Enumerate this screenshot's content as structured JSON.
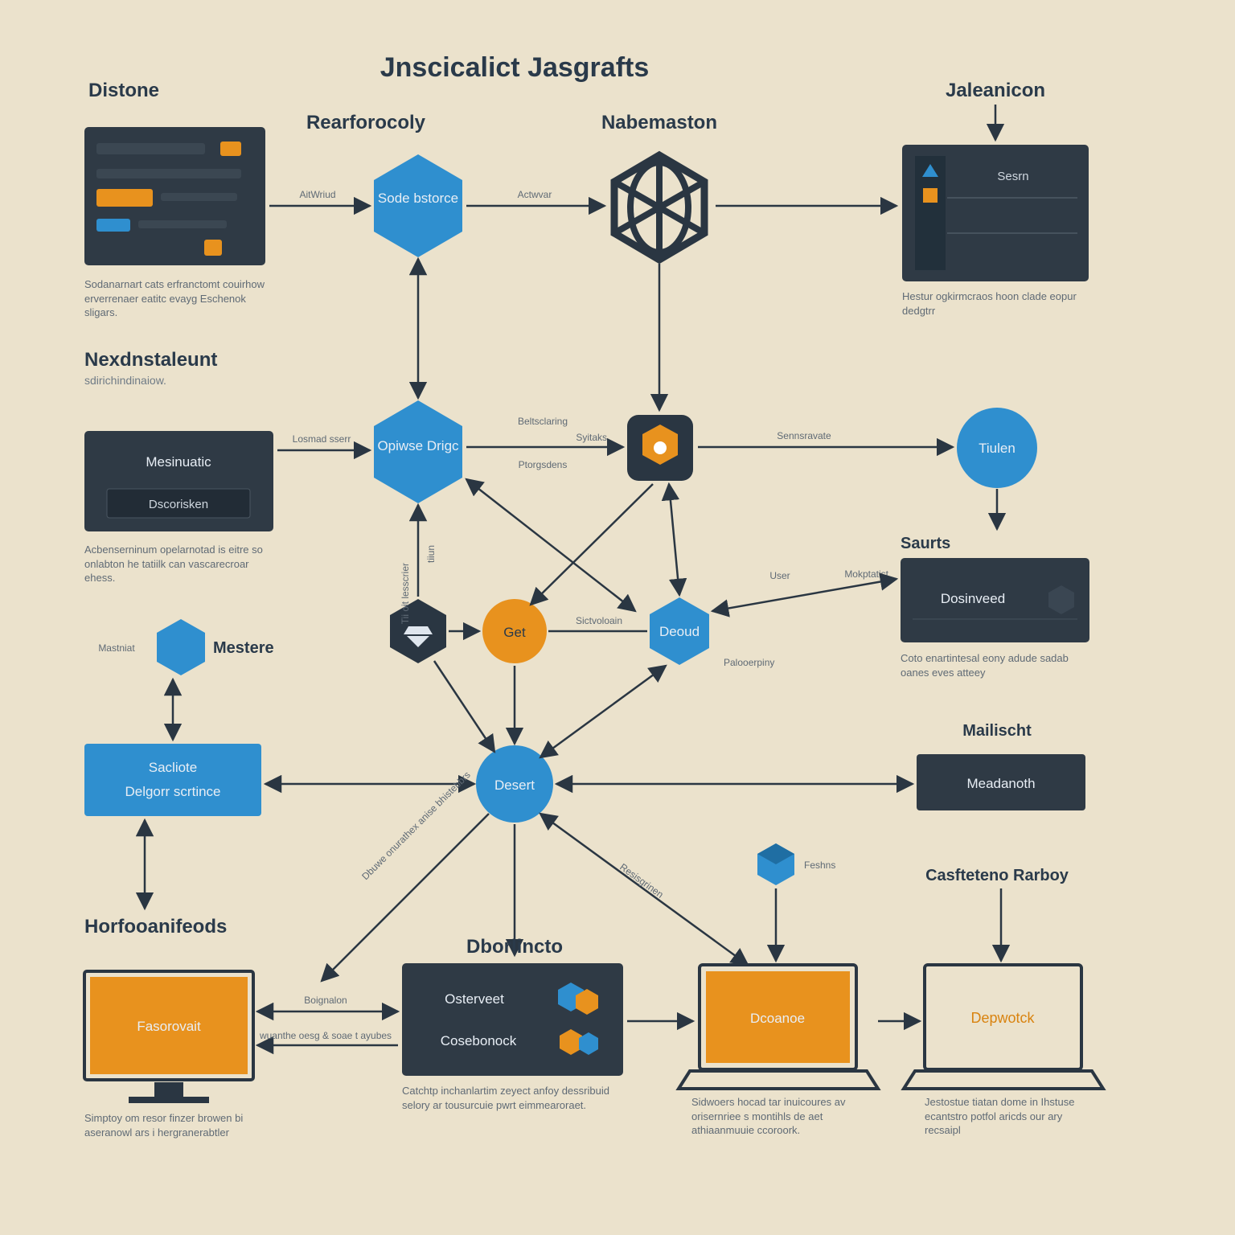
{
  "title": "Jnscicalict Jasgrafts",
  "sections": {
    "distone": {
      "heading": "Distone",
      "caption": "Sodanarnart cats erfranctomt couirhow erverrenaer eatitc evayg Eschenok sligars."
    },
    "rearforocoly": {
      "heading": "Rearforocoly"
    },
    "nabemaston": {
      "heading": "Nabemaston"
    },
    "jaleanicon": {
      "heading": "Jaleanicon",
      "caption": "Hestur ogkirmcraos hoon clade eopur dedgtrr"
    },
    "nexdnstaleunt": {
      "heading": "Nexdnstaleunt",
      "sub": "sdirichindinaiow."
    },
    "saurts": {
      "heading": "Saurts",
      "caption": "Coto enartintesal eony adude sadab oanes eves atteey"
    },
    "mailischt": {
      "heading": "Mailischt"
    },
    "casttenok": {
      "heading": "Casfteteno Rarboy"
    },
    "horfooanifeods": {
      "heading": "Horfooanifeods",
      "caption": "Simptoy om resor finzer browen bi aseranowl ars i hergranerabtler"
    },
    "dborlincto": {
      "heading": "Dborlincto",
      "caption": "Catchtp inchanlartim zeyect anfoy dessribuid selory ar tousurcuie pwrt eimmearoraet."
    },
    "dcoanoe_cap": "Sidwoers hocad tar inuicoures av orisernriee s montihls de aet athiaanmuuie ccoroork.",
    "depwork_cap": "Jestostue tiatan dome in Ihstuse ecantstro potfol aricds our ary recsaipl"
  },
  "nodes": {
    "sode": "Sode bstorce",
    "opiwse": "Opiwse Drigc",
    "get": "Get",
    "desert": "Desert",
    "deoud": "Deoud",
    "tiulen": "Tiulen",
    "mesinuatic": "Mesinuatic",
    "mesinuatic_btn": "Dscorisken",
    "mesinuatic_cap": "Acbenserninum opelarnotad is eitre so onlabton he tatiilk can vascarecroar ehess.",
    "mastnic": "Mastniat",
    "mestere": "Mestere",
    "sacliote1": "Sacliote",
    "sacliote2": "Delgorr scrtince",
    "meadanoth": "Meadanoth",
    "fasorovait": "Fasorovait",
    "osterveet": "Osterveet",
    "cosebonock": "Cosebonock",
    "dcoanoe": "Dcoanoe",
    "depwork": "Depwotck",
    "dosinveed": "Dosinveed",
    "sesrn": "Sesrn",
    "mokptatist": "Mokptatist"
  },
  "edges": {
    "aitwriud": "AitWriud",
    "acwvar": "Actwvar",
    "losmad": "Losmad sserr",
    "beltsclaring": "Beltsclaring",
    "syitaks": "Syitaks",
    "ptorgsdens": "Ptorgsdens",
    "tiioit": "Tii oit lesscrier",
    "sictvoloain": "Sictvoloain",
    "palooerpiny": "Palooerpiny",
    "user": "User",
    "sensravate": "Sennsravate",
    "tiun": "tiiun",
    "resergn": "Resisgrinen",
    "feshns": "Feshns",
    "boignalon": "Boignalon",
    "wuanthe": "wuanthe oesg & soae t ayubes",
    "dbuwe": "Dbuwe onurathex anise bhistebbrs"
  }
}
